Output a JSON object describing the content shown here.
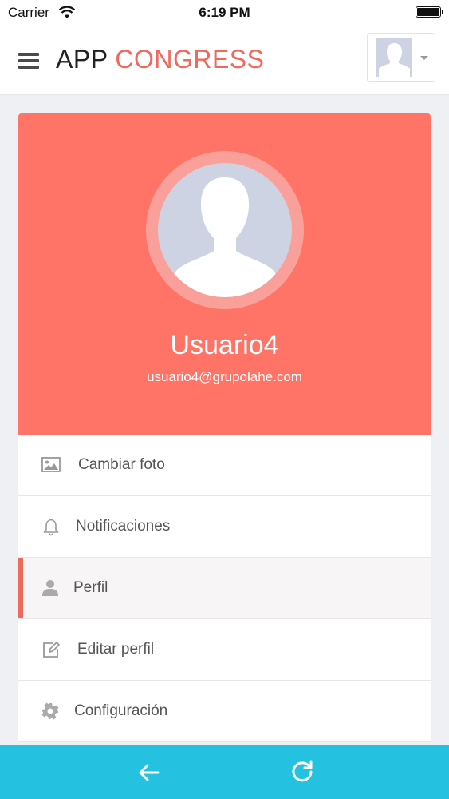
{
  "status_bar": {
    "carrier": "Carrier",
    "time": "6:19 PM"
  },
  "header": {
    "title_part1": "APP",
    "title_part2": "CONGRESS"
  },
  "profile": {
    "username": "Usuario4",
    "email": "usuario4@grupolahe.com"
  },
  "menu": {
    "items": [
      {
        "label": "Cambiar foto",
        "icon": "image-icon"
      },
      {
        "label": "Notificaciones",
        "icon": "bell-icon"
      },
      {
        "label": "Perfil",
        "icon": "user-icon",
        "active": true
      },
      {
        "label": "Editar perfil",
        "icon": "edit-icon"
      },
      {
        "label": "Configuración",
        "icon": "gear-icon"
      }
    ]
  },
  "colors": {
    "accent": "#f0695d",
    "profile_background": "#ff7467",
    "bottom_bar": "#24c1e0"
  },
  "bottom_bar": {
    "back_icon": "arrow-left-icon",
    "refresh_icon": "refresh-icon"
  }
}
